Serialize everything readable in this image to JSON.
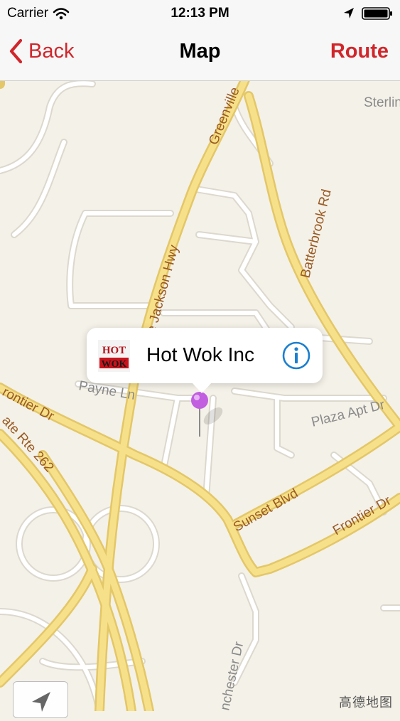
{
  "status_bar": {
    "carrier": "Carrier",
    "time": "12:13 PM"
  },
  "nav_bar": {
    "back_label": "Back",
    "title": "Map",
    "route_label": "Route"
  },
  "map": {
    "road_labels": {
      "greenville": "Greenville",
      "sterling": "Sterlin",
      "batterbrook": "Batterbrook Rd",
      "jackson_hwy": "e Jackson Hwy",
      "payne": "Payne Ln",
      "frontier_left": "rontier Dr",
      "state_rte": "ate Rte 262",
      "plaza": "Plaza Apt Dr",
      "sunset": "Sunset Blvd",
      "frontier_right": "Frontier Dr",
      "winchester": "nchester Dr"
    },
    "attribution": "高德地图"
  },
  "callout": {
    "title": "Hot Wok Inc",
    "thumb_top": "HOT",
    "thumb_bottom": "WOK"
  },
  "colors": {
    "accent": "#d0262b",
    "road": "#f7e08a",
    "info": "#1a7fd0",
    "pin": "#c25ee0"
  }
}
